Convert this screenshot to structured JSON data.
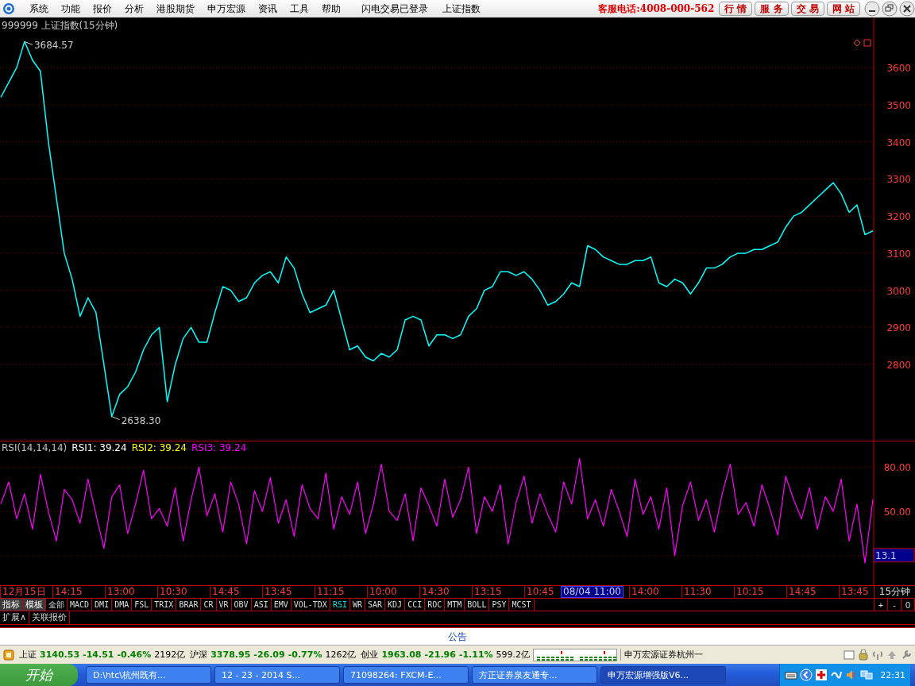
{
  "menu": [
    "系统",
    "功能",
    "报价",
    "分析",
    "港股期货",
    "申万宏源",
    "资讯",
    "工具",
    "帮助"
  ],
  "header": {
    "login_status": "闪电交易已登录",
    "index_name": "上证指数",
    "hotline": "客服电话:4008-000-562",
    "site_buttons": [
      "行 情",
      "服 务",
      "交 易",
      "网 站"
    ]
  },
  "price_chart": {
    "title": "999999 上证指数(15分钟)",
    "chart_data": {
      "type": "line",
      "ylim": [
        2595,
        3735
      ],
      "yticks": [
        2800,
        2900,
        3000,
        3100,
        3200,
        3300,
        3400,
        3500,
        3600
      ],
      "series": [
        {
          "color": "#00ffff",
          "values": [
            3520,
            3560,
            3600,
            3670,
            3620,
            3590,
            3400,
            3250,
            3100,
            3030,
            2930,
            2980,
            2940,
            2800,
            2660,
            2720,
            2740,
            2780,
            2840,
            2880,
            2900,
            2700,
            2800,
            2870,
            2900,
            2860,
            2860,
            2940,
            3010,
            3000,
            2970,
            2980,
            3020,
            3040,
            3050,
            3020,
            3090,
            3060,
            2990,
            2940,
            2950,
            2960,
            3000,
            2920,
            2840,
            2850,
            2820,
            2810,
            2830,
            2820,
            2840,
            2920,
            2930,
            2920,
            2850,
            2880,
            2880,
            2870,
            2880,
            2930,
            2950,
            3000,
            3010,
            3050,
            3050,
            3040,
            3050,
            3030,
            3000,
            2960,
            2970,
            2990,
            3020,
            3010,
            3120,
            3110,
            3090,
            3080,
            3070,
            3070,
            3080,
            3080,
            3090,
            3020,
            3010,
            3030,
            3020,
            2990,
            3020,
            3060,
            3060,
            3070,
            3090,
            3100,
            3100,
            3110,
            3110,
            3120,
            3130,
            3170,
            3200,
            3210,
            3230,
            3250,
            3270,
            3290,
            3260,
            3210,
            3230,
            3150,
            3160
          ]
        }
      ],
      "grid": true,
      "annotations": [
        "3684.57",
        "2638.30"
      ]
    }
  },
  "rsi_panel": {
    "legend": [
      {
        "text": "RSI(14,14,14)",
        "color": "#c0c0c0"
      },
      {
        "text": "RSI1: 39.24",
        "color": "#ffffff"
      },
      {
        "text": "RSI2: 39.24",
        "color": "#ffff00"
      },
      {
        "text": "RSI3: 39.24",
        "color": "#ff00ff"
      }
    ],
    "cursor_reading": "13.1",
    "chart_data": {
      "type": "line",
      "ylim": [
        0,
        98
      ],
      "grid": true,
      "yticks": [
        {
          "value": 80,
          "label": "80.00"
        },
        {
          "value": 50,
          "label": "50.00"
        }
      ],
      "series": [
        {
          "color": "#ff00ff",
          "values": [
            55,
            70,
            45,
            62,
            38,
            75,
            50,
            30,
            65,
            58,
            42,
            72,
            48,
            25,
            60,
            68,
            35,
            55,
            78,
            45,
            52,
            40,
            66,
            30,
            58,
            80,
            47,
            62,
            36,
            70,
            55,
            28,
            64,
            50,
            73,
            42,
            58,
            33,
            68,
            52,
            45,
            76,
            38,
            60,
            48,
            70,
            35,
            55,
            82,
            50,
            44,
            62,
            30,
            66,
            54,
            40,
            72,
            46,
            58,
            80,
            35,
            60,
            50,
            68,
            28,
            56,
            74,
            42,
            62,
            48,
            36,
            70,
            55,
            86,
            45,
            58,
            40,
            65,
            50,
            33,
            72,
            48,
            60,
            38,
            66,
            20,
            54,
            70,
            44,
            58,
            36,
            62,
            82,
            48,
            56,
            40,
            68,
            52,
            34,
            74,
            58,
            45,
            66,
            38,
            60,
            50,
            72,
            30,
            55,
            15,
            58
          ]
        }
      ]
    }
  },
  "time_axis": {
    "labels": [
      {
        "text": "12月15日",
        "kind": "tick"
      },
      {
        "text": "14:15",
        "kind": "tick"
      },
      {
        "text": "13:00",
        "kind": "tick"
      },
      {
        "text": "10:30",
        "kind": "tick"
      },
      {
        "text": "14:45",
        "kind": "tick"
      },
      {
        "text": "13:45",
        "kind": "tick"
      },
      {
        "text": "11:15",
        "kind": "tick"
      },
      {
        "text": "10:00",
        "kind": "tick"
      },
      {
        "text": "14:30",
        "kind": "tick"
      },
      {
        "text": "13:15",
        "kind": "tick"
      },
      {
        "text": "10:45",
        "kind": "tick"
      },
      {
        "text": "08/04 11:00",
        "kind": "cursor"
      },
      {
        "text": "14:00",
        "kind": "tick"
      },
      {
        "text": "11:30",
        "kind": "tick"
      },
      {
        "text": "10:15",
        "kind": "tick"
      },
      {
        "text": "14:45",
        "kind": "tick"
      },
      {
        "text": "13:45",
        "kind": "tick"
      }
    ],
    "period": "15分钟"
  },
  "indicator_tabs": [
    {
      "label": "指标",
      "kind": "mode",
      "selected": false
    },
    {
      "label": "模板",
      "kind": "mode",
      "selected": false
    },
    {
      "label": "全部",
      "kind": "indicator",
      "selected": false
    },
    {
      "label": "MACD",
      "kind": "indicator",
      "selected": false
    },
    {
      "label": "DMI",
      "kind": "indicator",
      "selected": false
    },
    {
      "label": "DMA",
      "kind": "indicator",
      "selected": false
    },
    {
      "label": "FSL",
      "kind": "indicator",
      "selected": false
    },
    {
      "label": "TRIX",
      "kind": "indicator",
      "selected": false
    },
    {
      "label": "BRAR",
      "kind": "indicator",
      "selected": false
    },
    {
      "label": "CR",
      "kind": "indicator",
      "selected": false
    },
    {
      "label": "VR",
      "kind": "indicator",
      "selected": false
    },
    {
      "label": "OBV",
      "kind": "indicator",
      "selected": false
    },
    {
      "label": "ASI",
      "kind": "indicator",
      "selected": false
    },
    {
      "label": "EMV",
      "kind": "indicator",
      "selected": false
    },
    {
      "label": "VOL-TDX",
      "kind": "indicator",
      "selected": false
    },
    {
      "label": "RSI",
      "kind": "indicator",
      "selected": true
    },
    {
      "label": "WR",
      "kind": "indicator",
      "selected": false
    },
    {
      "label": "SAR",
      "kind": "indicator",
      "selected": false
    },
    {
      "label": "KDJ",
      "kind": "indicator",
      "selected": false
    },
    {
      "label": "CCI",
      "kind": "indicator",
      "selected": false
    },
    {
      "label": "ROC",
      "kind": "indicator",
      "selected": false
    },
    {
      "label": "MTM",
      "kind": "indicator",
      "selected": false
    },
    {
      "label": "BOLL",
      "kind": "indicator",
      "selected": false
    },
    {
      "label": "PSY",
      "kind": "indicator",
      "selected": false
    },
    {
      "label": "MCST",
      "kind": "indicator",
      "selected": false
    }
  ],
  "zoom_buttons": [
    "+",
    "-",
    "0"
  ],
  "extra_tabs": [
    "扩展∧",
    "关联报价"
  ],
  "notice": "公告",
  "market_summary": [
    {
      "name": "上证",
      "value": "3140.53",
      "change": "-14.51",
      "percent": "-0.46%",
      "volume": "2192亿"
    },
    {
      "name": "沪深",
      "value": "3378.95",
      "change": "-26.09",
      "percent": "-0.77%",
      "volume": "1262亿"
    },
    {
      "name": "创业",
      "value": "1963.08",
      "change": "-21.96",
      "percent": "-1.11%",
      "volume": "599.2亿"
    }
  ],
  "broker": "申万宏源证券杭州一",
  "taskbar": {
    "start": "开始",
    "tasks": [
      {
        "label": "D:\\htc\\杭州既有...",
        "selected": false
      },
      {
        "label": "12 - 23 - 2014 S...",
        "selected": false
      },
      {
        "label": "71098264: FXCM-E...",
        "selected": false
      },
      {
        "label": "方正证券泉友通专...",
        "selected": false
      },
      {
        "label": "申万宏源增强版V6...",
        "selected": true
      }
    ],
    "clock": "22:31"
  }
}
